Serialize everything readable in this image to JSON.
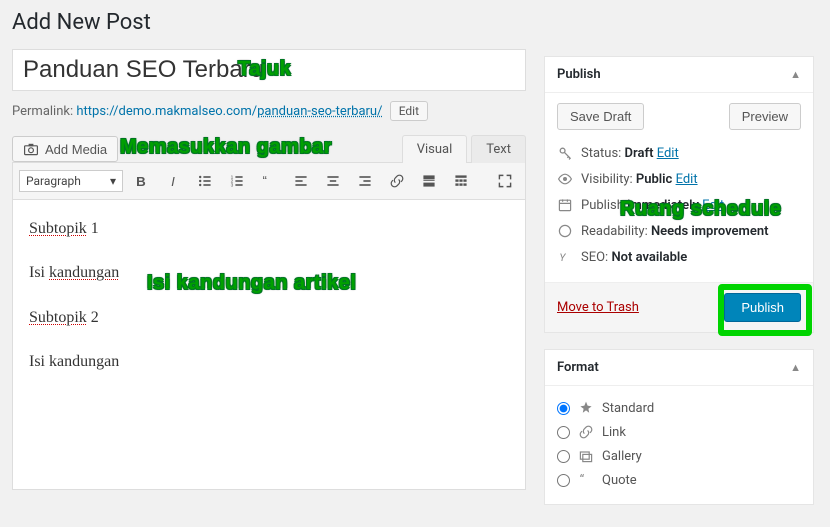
{
  "page_title": "Add New Post",
  "post_title": "Panduan SEO Terbaru",
  "permalink": {
    "label": "Permalink:",
    "base": "https://demo.makmalseo.com/",
    "slug": "panduan-seo-terbaru/",
    "edit": "Edit"
  },
  "media_button": "Add Media",
  "tabs": {
    "visual": "Visual",
    "text": "Text"
  },
  "toolbar": {
    "format_select": "Paragraph"
  },
  "editor": {
    "l1a": "Subtopik",
    "l1b": " 1",
    "l2a": "Isi ",
    "l2b": "kandungan",
    "l3a": "Subtopik",
    "l3b": " 2",
    "l4": "Isi kandungan"
  },
  "publish": {
    "heading": "Publish",
    "save_draft": "Save Draft",
    "preview": "Preview",
    "status_label": "Status: ",
    "status_value": "Draft",
    "status_edit": "Edit",
    "vis_label": "Visibility: ",
    "vis_value": "Public",
    "vis_edit": "Edit",
    "sched_label": "Publish ",
    "sched_value": "immediately",
    "sched_edit": "Edit",
    "read_label": "Readability: ",
    "read_value": "Needs improvement",
    "seo_label": "SEO: ",
    "seo_value": "Not available",
    "trash": "Move to Trash",
    "publish_btn": "Publish"
  },
  "format": {
    "heading": "Format",
    "items": [
      "Standard",
      "Link",
      "Gallery",
      "Quote"
    ]
  },
  "annotations": {
    "tajuk": "Tajuk",
    "gambar": "Memasukkan gambar",
    "isi": "Isi kandungan artikel",
    "schedule": "Ruang schedule"
  }
}
